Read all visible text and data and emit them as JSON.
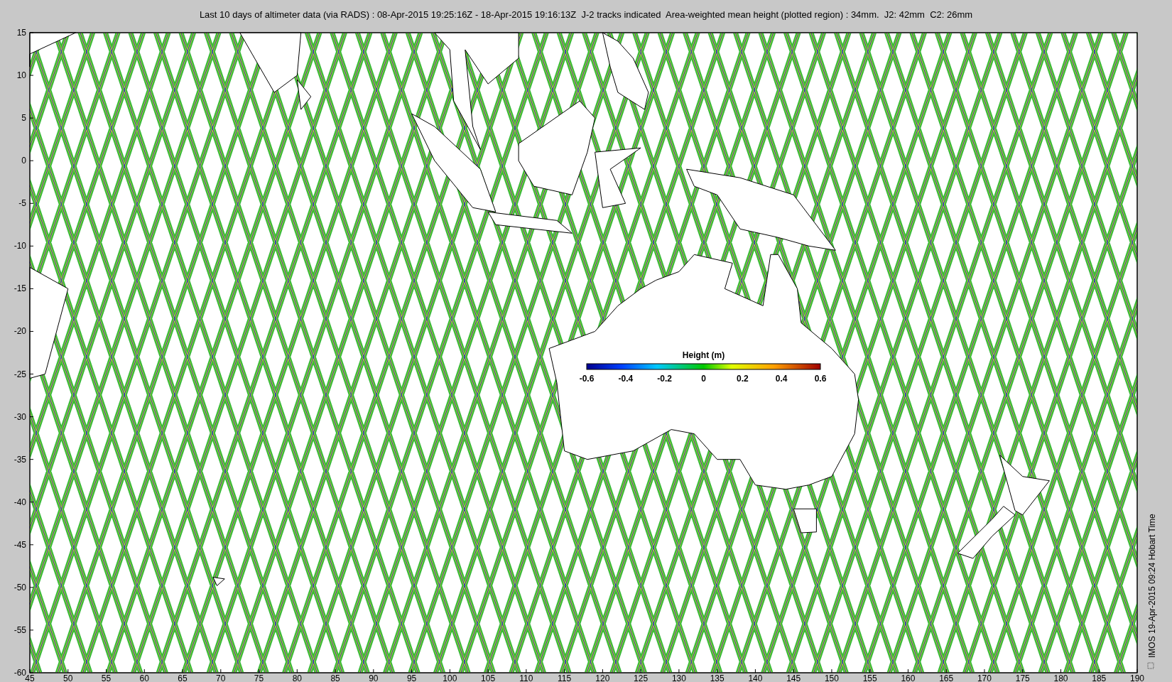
{
  "title": "Last 10 days of altimeter data (via RADS) : 08-Apr-2015 19:25:16Z - 18-Apr-2015 19:16:13Z  J-2 tracks indicated  Area-weighted mean height (plotted region) : 34mm.  J2: 42mm  C2: 26mm",
  "map": {
    "y_tick_labels": [
      "15",
      "10",
      "5",
      "0",
      "-5",
      "-10",
      "-15",
      "-20",
      "-25",
      "-30",
      "-35",
      "-40",
      "-45",
      "-50",
      "-55",
      "-60"
    ],
    "x_tick_labels": [
      "45",
      "50",
      "55",
      "60",
      "65",
      "70",
      "75",
      "80",
      "85",
      "90",
      "95",
      "100",
      "105",
      "110",
      "115",
      "120",
      "125",
      "130",
      "135",
      "140",
      "145",
      "150",
      "155",
      "160",
      "165",
      "170",
      "175",
      "180",
      "185",
      "190"
    ],
    "colorbar": {
      "title": "Height (m)",
      "tick_labels": [
        "-0.6",
        "-0.4",
        "-0.2",
        "0",
        "0.2",
        "0.4",
        "0.6"
      ]
    }
  },
  "side_label": "IMOS 19-Apr-2015 09:24 Hobart Time"
}
